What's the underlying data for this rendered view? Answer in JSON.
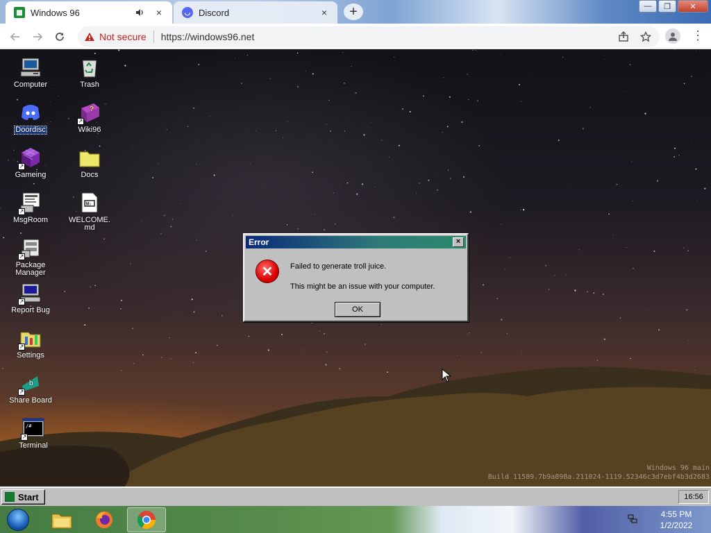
{
  "browser": {
    "tabs": [
      {
        "title": "Windows 96",
        "favicon": "windows96-favicon",
        "audio_icon": "speaker-icon",
        "close": "×"
      },
      {
        "title": "Discord",
        "favicon": "discord-favicon",
        "close": "×"
      }
    ],
    "new_tab": "+",
    "security_label": "Not secure",
    "url": "https://windows96.net"
  },
  "desktop": {
    "icons": [
      {
        "label": "Computer",
        "icon": "computer-icon"
      },
      {
        "label": "Trash",
        "icon": "recycle-bin-icon"
      },
      {
        "label": "Doordisc",
        "icon": "discord-icon",
        "selected": true
      },
      {
        "label": "Wiki96",
        "icon": "book-icon"
      },
      {
        "label": "Gameing",
        "icon": "purple-cube-icon"
      },
      {
        "label": "Docs",
        "icon": "folder-icon"
      },
      {
        "label": "MsgRoom",
        "icon": "msgroom-icon"
      },
      {
        "label": "WELCOME.md",
        "icon": "markdown-file-icon"
      },
      {
        "label": "Package Manager",
        "icon": "package-icon"
      },
      {
        "label": "Report Bug",
        "icon": "bug-report-icon"
      },
      {
        "label": "Settings",
        "icon": "settings-folder-icon"
      },
      {
        "label": "Share Board",
        "icon": "share-board-icon"
      },
      {
        "label": "Terminal",
        "icon": "terminal-icon"
      }
    ],
    "watermark_line1": "Windows 96 main",
    "watermark_line2": "Build 11589.7b9a898a.211024-1119.52346c3d7ebf4b3d2683"
  },
  "dialog": {
    "title": "Error",
    "close": "×",
    "message": "Failed to generate troll juice.",
    "detail": "This might be an issue with your computer.",
    "ok_label": "OK"
  },
  "taskbar96": {
    "start_label": "Start",
    "clock": "16:56"
  },
  "host_taskbar": {
    "time": "4:55 PM",
    "date": "1/2/2022"
  }
}
